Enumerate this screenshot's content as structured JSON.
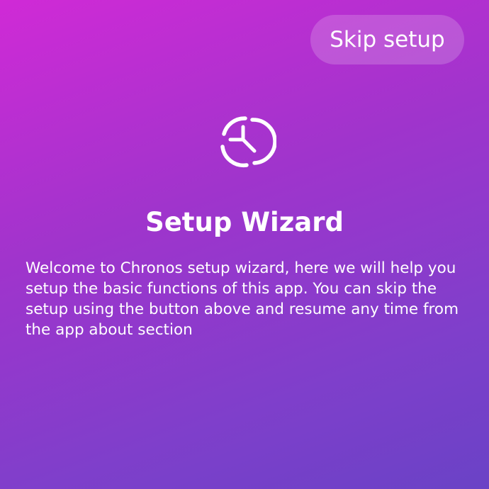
{
  "header": {
    "skip_label": "Skip setup"
  },
  "icon": {
    "name": "clock-icon"
  },
  "main": {
    "title": "Setup Wizard",
    "description": "Welcome to Chronos setup wizard, here we will help you setup the basic functions of this app. You can skip the setup using the button above and resume any time from the app about section"
  },
  "colors": {
    "gradient_start": "#d02ad6",
    "gradient_end": "#6a42c6",
    "text": "#ffffff"
  }
}
